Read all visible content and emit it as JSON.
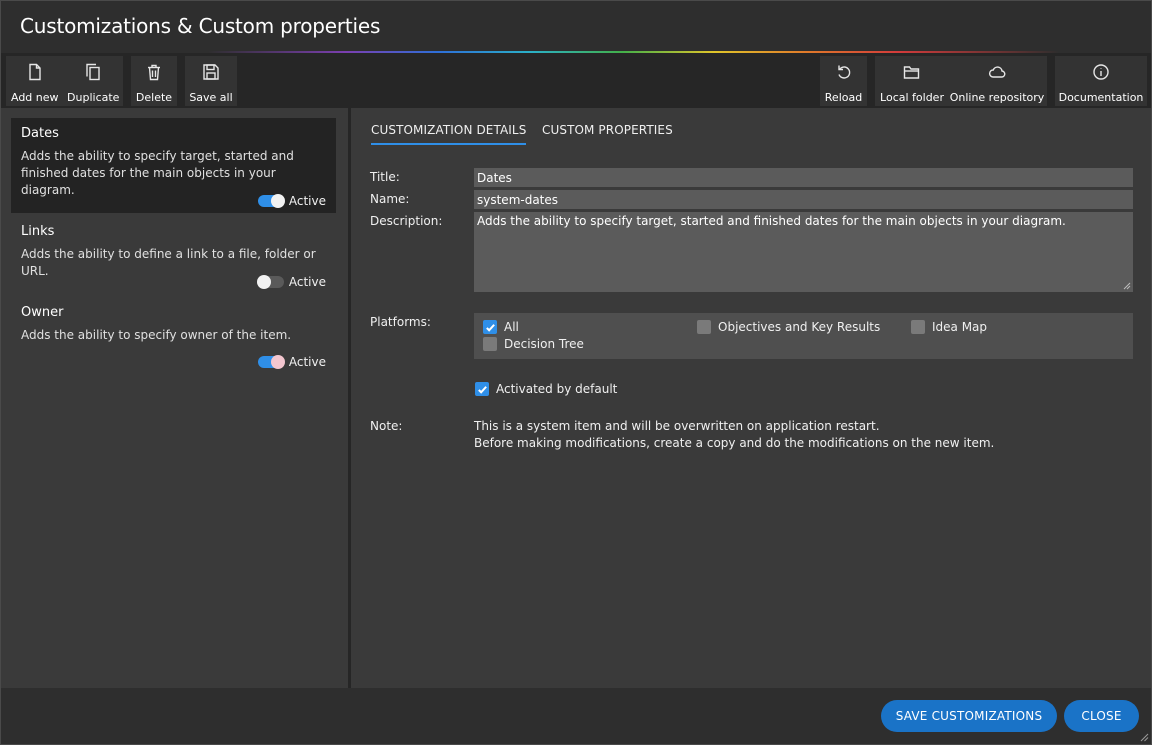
{
  "window": {
    "title": "Customizations & Custom properties"
  },
  "toolbar": {
    "left": [
      {
        "label": "Add new",
        "icon": "file-icon"
      },
      {
        "label": "Duplicate",
        "icon": "copy-icon"
      },
      {
        "label": "Delete",
        "icon": "trash-icon"
      },
      {
        "label": "Save all",
        "icon": "floppy-icon"
      }
    ],
    "right": [
      {
        "label": "Reload",
        "icon": "reload-icon"
      },
      {
        "label": "Local folder",
        "icon": "folder-icon"
      },
      {
        "label": "Online repository",
        "icon": "cloud-icon"
      },
      {
        "label": "Documentation",
        "icon": "info-icon"
      }
    ]
  },
  "customizations": [
    {
      "title": "Dates",
      "description": "Adds the ability to specify target, started and finished dates for the main objects in your diagram.",
      "active_label": "Active",
      "active": true,
      "selected": true
    },
    {
      "title": "Links",
      "description": "Adds the ability to define a link to a file, folder or URL.",
      "active_label": "Active",
      "active": false,
      "selected": false
    },
    {
      "title": "Owner",
      "description": "Adds the ability to specify owner of the item.",
      "active_label": "Active",
      "active": true,
      "selected": false
    }
  ],
  "tabs": [
    {
      "label": "CUSTOMIZATION DETAILS",
      "active": true
    },
    {
      "label": "CUSTOM PROPERTIES",
      "active": false
    }
  ],
  "details": {
    "title_label": "Title:",
    "title_value": "Dates",
    "name_label": "Name:",
    "name_value": "system-dates",
    "description_label": "Description:",
    "description_value": "Adds the ability to specify target, started and finished dates for the main objects in your diagram.",
    "platforms_label": "Platforms:",
    "platforms": [
      {
        "label": "All",
        "checked": true
      },
      {
        "label": "Objectives and Key Results",
        "checked": false
      },
      {
        "label": "Idea Map",
        "checked": false
      },
      {
        "label": "Decision Tree",
        "checked": false
      }
    ],
    "activated_label": "Activated by default",
    "activated_checked": true,
    "note_label": "Note:",
    "note_line1": "This is a system item and will be overwritten on application restart.",
    "note_line2": "Before making modifications, create a copy and do the modifications on the new item."
  },
  "footer": {
    "save_label": "SAVE CUSTOMIZATIONS",
    "close_label": "CLOSE"
  },
  "colors": {
    "accent": "#2f8fe8",
    "button": "#1a73c7",
    "background": "#333333",
    "panel": "#3a3a3a",
    "selected_item": "#232323"
  }
}
